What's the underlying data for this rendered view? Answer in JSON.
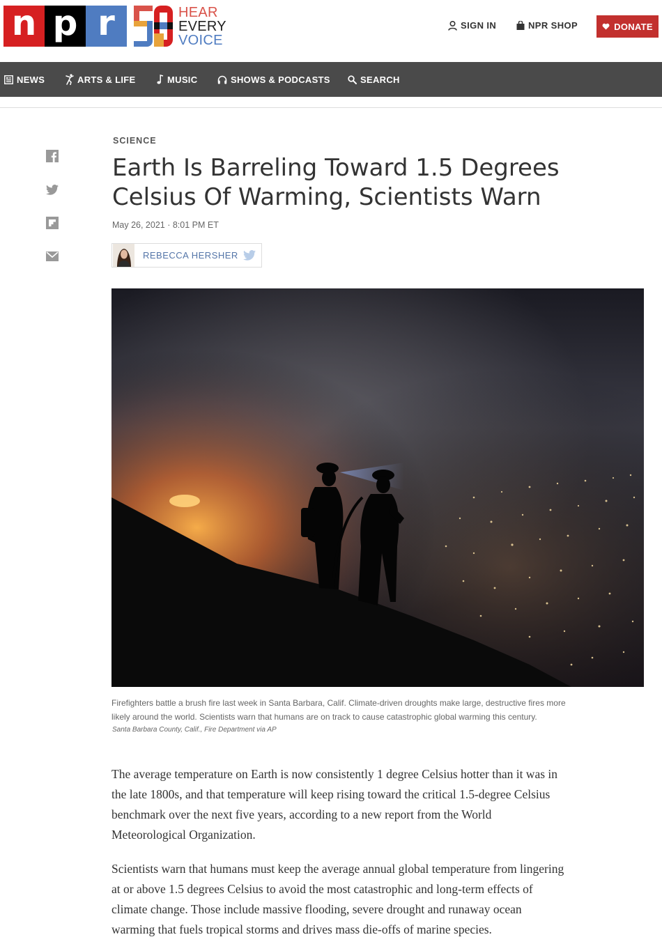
{
  "brand": {
    "logo_letters": [
      "n",
      "p",
      "r"
    ],
    "campaign_lines": [
      "HEAR",
      "EVERY",
      "VOICE"
    ],
    "colors": {
      "red": "#d62021",
      "black": "#000000",
      "blue": "#4f7cc1",
      "donate": "#c2302e",
      "nav": "#4a4a4a",
      "author_link": "#5475a8"
    }
  },
  "header": {
    "sign_in": {
      "label": "SIGN IN",
      "icon": "user-icon"
    },
    "shop": {
      "label": "NPR SHOP",
      "icon": "bag-icon"
    },
    "donate": {
      "label": "DONATE",
      "icon": "heart-icon"
    }
  },
  "nav": {
    "items": [
      {
        "label": "NEWS",
        "icon": "news-icon"
      },
      {
        "label": "ARTS & LIFE",
        "icon": "dancer-icon"
      },
      {
        "label": "MUSIC",
        "icon": "music-note-icon"
      },
      {
        "label": "SHOWS & PODCASTS",
        "icon": "headphones-icon"
      },
      {
        "label": "SEARCH",
        "icon": "search-icon"
      }
    ]
  },
  "share": [
    "facebook-icon",
    "twitter-icon",
    "flipboard-icon",
    "email-icon"
  ],
  "article": {
    "slug": "SCIENCE",
    "title": "Earth Is Barreling Toward 1.5 Degrees Celsius Of Warming, Scientists Warn",
    "date": "May 26, 2021 · 8:01 PM ET",
    "author": "REBECCA HERSHER",
    "caption": "Firefighters battle a brush fire last week in Santa Barbara, Calif. Climate-driven droughts make large, destructive fires more likely around the world. Scientists warn that humans are on track to cause catastrophic global warming this century.",
    "credit": "Santa Barbara County, Calif., Fire Department via AP",
    "paragraphs": [
      "The average temperature on Earth is now consistently 1 degree Celsius hotter than it was in the late 1800s, and that temperature will keep rising toward the critical 1.5-degree Celsius benchmark over the next five years, according to a new report from the World Meteorological Organization.",
      "Scientists warn that humans must keep the average annual global temperature from lingering at or above 1.5 degrees Celsius to avoid the most catastrophic and long-term effects of climate change. Those include massive flooding, severe drought and runaway ocean warming that fuels tropical storms and drives mass die-offs of marine species."
    ]
  }
}
